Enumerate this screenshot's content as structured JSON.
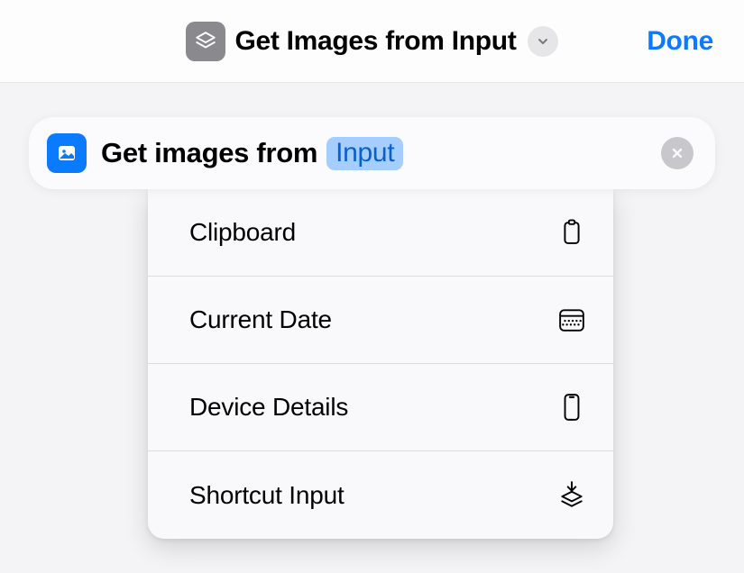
{
  "header": {
    "title": "Get Images from Input",
    "done_label": "Done"
  },
  "action": {
    "prefix": "Get images from",
    "token": "Input"
  },
  "menu": {
    "items": [
      {
        "label": "Clipboard",
        "icon": "clipboard"
      },
      {
        "label": "Current Date",
        "icon": "calendar"
      },
      {
        "label": "Device Details",
        "icon": "phone"
      },
      {
        "label": "Shortcut Input",
        "icon": "shortcut-input"
      }
    ]
  }
}
